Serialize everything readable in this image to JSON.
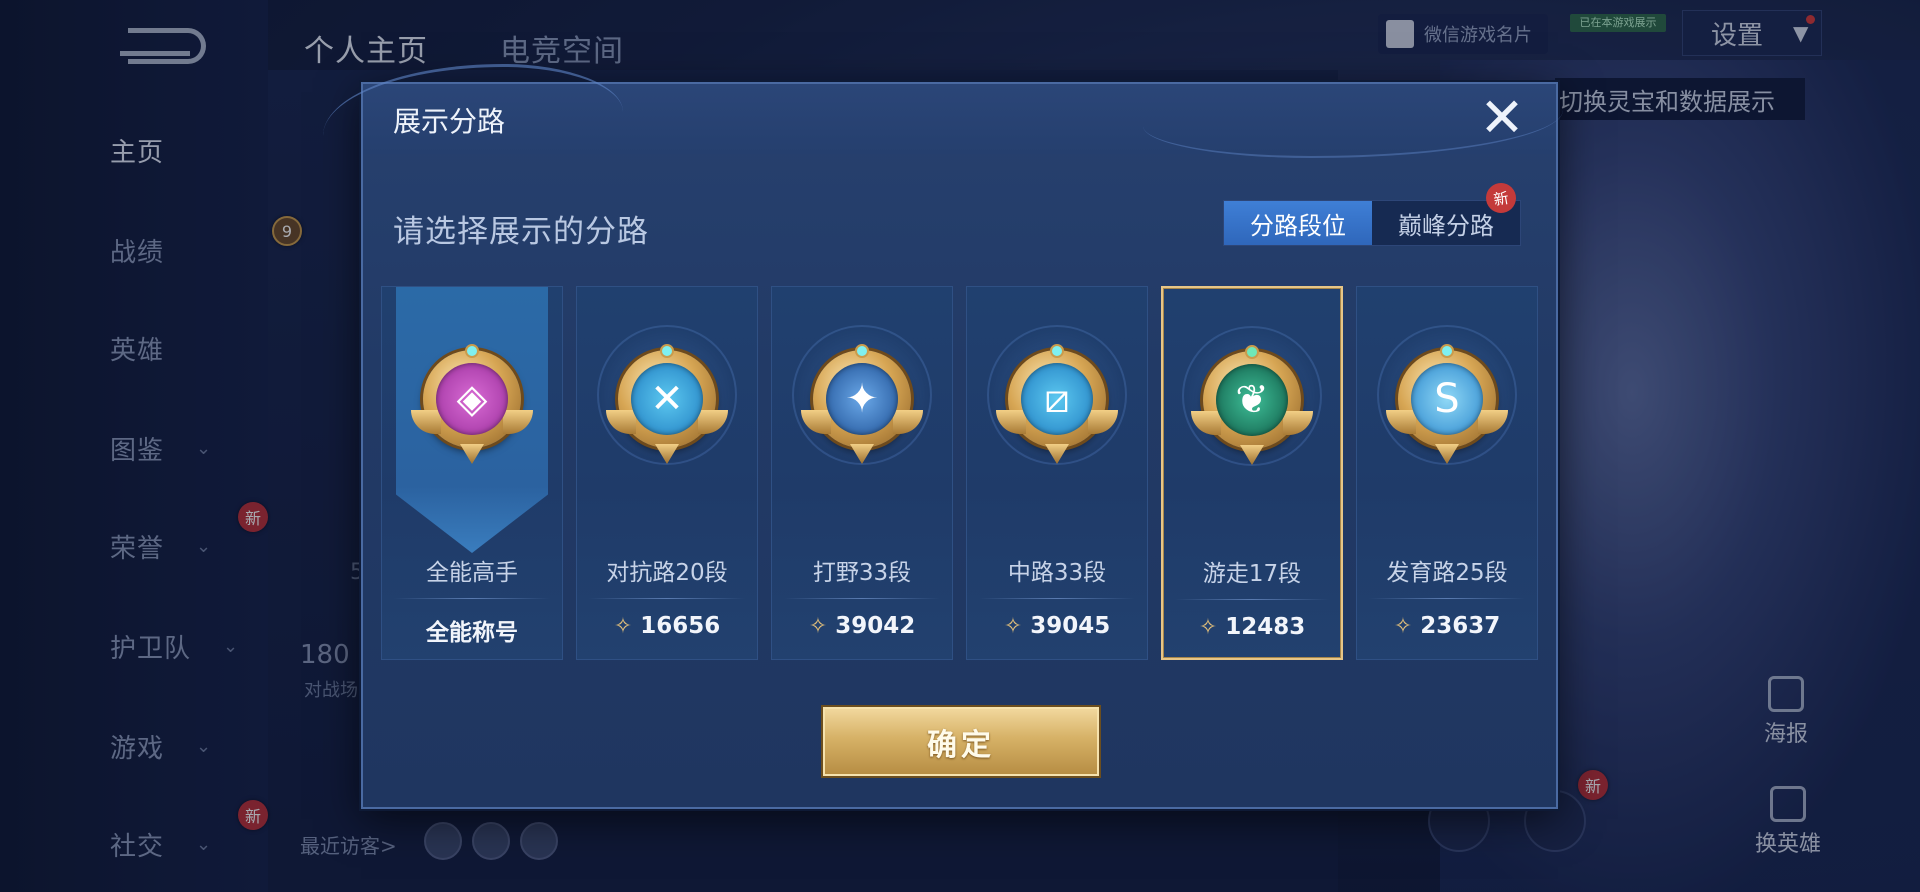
{
  "background": {
    "top_tabs": [
      "个人主页",
      "电竞空间"
    ],
    "sidebar": [
      {
        "label": "主页",
        "active": true,
        "chevron": false
      },
      {
        "label": "战绩",
        "active": false,
        "chevron": false
      },
      {
        "label": "英雄",
        "active": false,
        "chevron": false
      },
      {
        "label": "图鉴",
        "active": false,
        "chevron": true
      },
      {
        "label": "荣誉",
        "active": false,
        "chevron": true,
        "new": "新"
      },
      {
        "label": "护卫队",
        "active": false,
        "chevron": true
      },
      {
        "label": "游戏",
        "active": false,
        "chevron": true
      },
      {
        "label": "社交",
        "active": false,
        "chevron": true,
        "new": "新"
      }
    ],
    "wechat_card": "微信游戏名片",
    "green_tag": "已在本游戏展示",
    "settings": "设置",
    "switch_hint": "切换灵宝和数据展示",
    "side_number": "180",
    "side_label": "对战场",
    "level_badge": "9",
    "small_number": "5",
    "recent_visitors": "最近访客>",
    "poster": "海报",
    "swap_hero": "换英雄",
    "new_badge": "新"
  },
  "modal": {
    "title": "展示分路",
    "subtitle": "请选择展示的分路",
    "toggle": {
      "options": [
        "分路段位",
        "巅峰分路"
      ],
      "active_index": 0,
      "new_tag": "新"
    },
    "cards": [
      {
        "name": "全能高手",
        "score": "全能称号",
        "score_icon": false,
        "icon": "all-round-medal",
        "inner_color": "#b94ab8",
        "glyph": "◈",
        "banner": true,
        "selected": false
      },
      {
        "name": "对抗路20段",
        "score": "16656",
        "score_icon": true,
        "icon": "clash-lane-medal",
        "inner_color": "#2f9bd6",
        "glyph": "✕",
        "banner": false,
        "selected": false
      },
      {
        "name": "打野33段",
        "score": "39042",
        "score_icon": true,
        "icon": "jungle-medal",
        "inner_color": "#2c6fb6",
        "glyph": "✦",
        "banner": false,
        "selected": false
      },
      {
        "name": "中路33段",
        "score": "39045",
        "score_icon": true,
        "icon": "mid-lane-medal",
        "inner_color": "#2f9bd6",
        "glyph": "⧄",
        "banner": false,
        "selected": false
      },
      {
        "name": "游走17段",
        "score": "12483",
        "score_icon": true,
        "icon": "roam-medal",
        "inner_color": "#1f7a63",
        "glyph": "❦",
        "banner": false,
        "selected": true
      },
      {
        "name": "发育路25段",
        "score": "23637",
        "score_icon": true,
        "icon": "farm-lane-medal",
        "inner_color": "#3aa0e0",
        "glyph": "S",
        "banner": false,
        "selected": false
      }
    ],
    "confirm": "确定",
    "close_glyph": "✕"
  },
  "colors": {
    "accent_gold": "#e7c687",
    "toggle_active": "#3f7fd6",
    "new_badge": "#c43a3a"
  }
}
